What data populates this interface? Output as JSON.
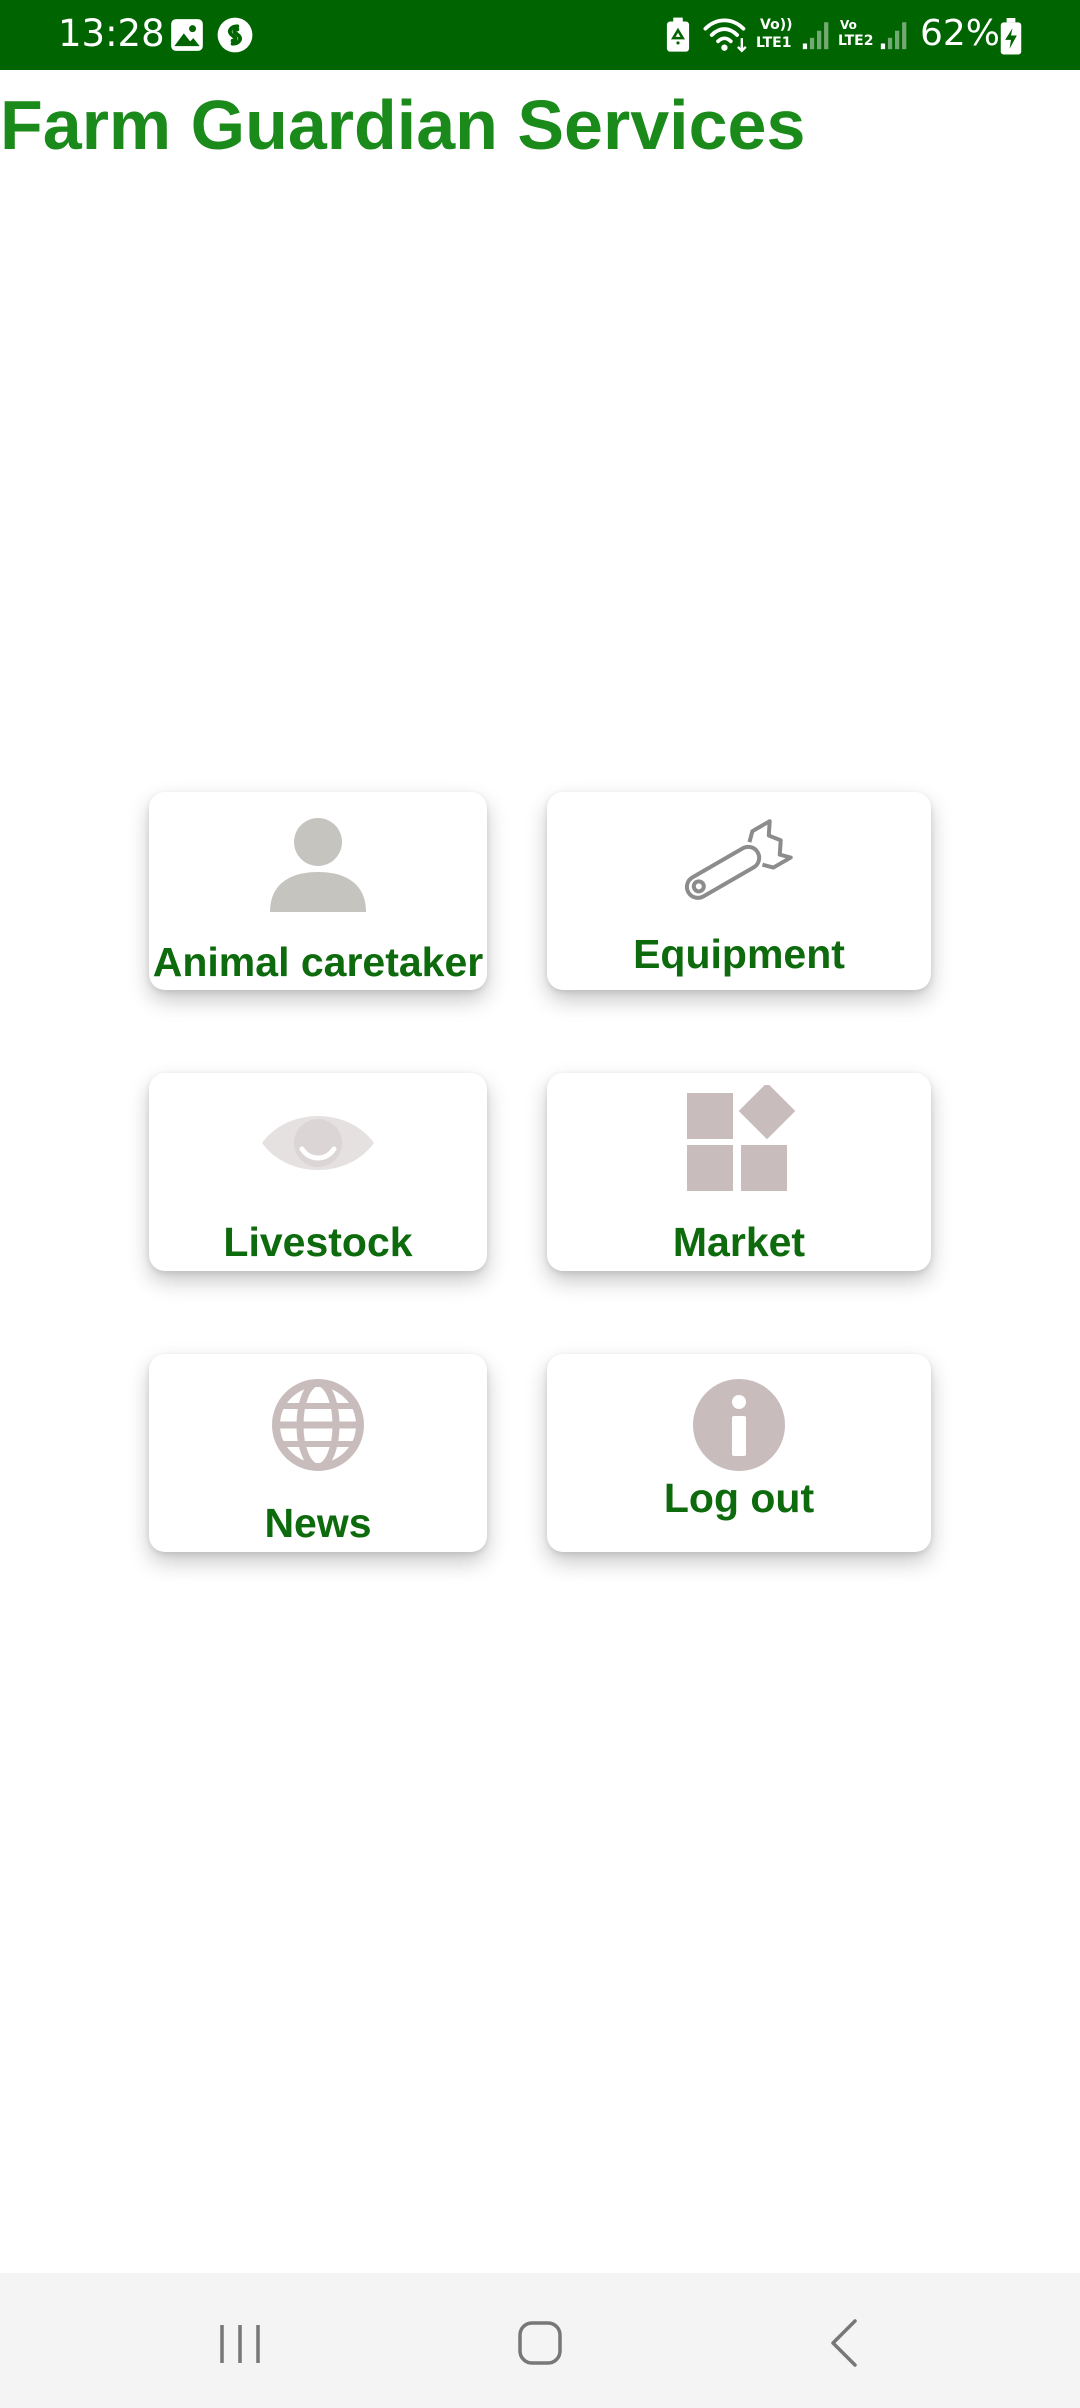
{
  "status_bar": {
    "time": "13:28",
    "battery_percent": "62%",
    "sim1_label_top": "Vo))",
    "sim1_label_bottom": "LTE1",
    "sim2_label_top": "Vo",
    "sim2_label_bottom": "LTE2",
    "icons": [
      "gallery-icon",
      "shazam-icon",
      "battery-saver-icon",
      "wifi-icon",
      "signal-sim1-icon",
      "signal-sim2-icon",
      "battery-charging-icon"
    ],
    "background_color": "#006400"
  },
  "app": {
    "title": "Farm Guardian Services",
    "title_color": "#1a8a1a",
    "label_color": "#0d6a0d",
    "icon_color": "#c8bcbc"
  },
  "menu": {
    "tiles": [
      {
        "label": "Animal caretaker",
        "icon": "person-icon"
      },
      {
        "label": "Equipment",
        "icon": "wrench-icon"
      },
      {
        "label": "Livestock",
        "icon": "eye-icon"
      },
      {
        "label": "Market",
        "icon": "widgets-icon"
      },
      {
        "label": "News",
        "icon": "globe-icon"
      },
      {
        "label": "Log out",
        "icon": "info-icon"
      }
    ]
  },
  "nav_bar": {
    "buttons": [
      "recent-apps-icon",
      "home-icon",
      "back-icon"
    ]
  }
}
